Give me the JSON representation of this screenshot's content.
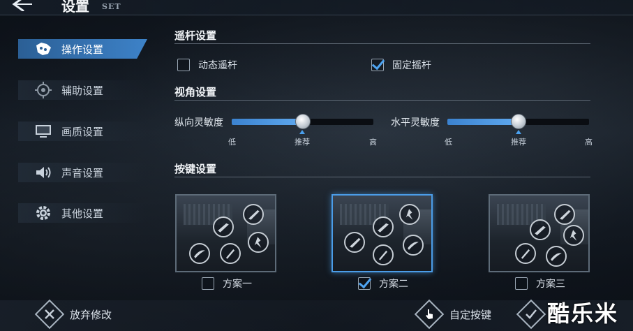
{
  "header": {
    "title": "设置",
    "subtitle": "SET"
  },
  "sidebar": {
    "items": [
      {
        "label": "操作设置",
        "icon": "gamepad-icon",
        "active": true
      },
      {
        "label": "辅助设置",
        "icon": "crosshair-icon",
        "active": false
      },
      {
        "label": "画质设置",
        "icon": "monitor-icon",
        "active": false
      },
      {
        "label": "声音设置",
        "icon": "speaker-icon",
        "active": false
      },
      {
        "label": "其他设置",
        "icon": "gear-icon",
        "active": false
      }
    ]
  },
  "joystick": {
    "title": "遥杆设置",
    "dynamic": {
      "label": "动态遥杆",
      "checked": false
    },
    "fixed": {
      "label": "固定摇杆",
      "checked": true
    }
  },
  "view": {
    "title": "视角设置",
    "vertical": {
      "label": "纵向灵敏度",
      "value": 0.5,
      "low": "低",
      "recommend": "推荐",
      "high": "高"
    },
    "horizontal": {
      "label": "水平灵敏度",
      "value": 0.5,
      "low": "低",
      "recommend": "推荐",
      "high": "高"
    }
  },
  "keys": {
    "title": "按键设置",
    "schemes": [
      {
        "label": "方案一",
        "checked": false
      },
      {
        "label": "方案二",
        "checked": true
      },
      {
        "label": "方案三",
        "checked": false
      }
    ]
  },
  "footer": {
    "discard": "放弃修改",
    "custom": "自定按键",
    "watermark": "酷乐米"
  },
  "colors": {
    "accent": "#4ea4f2",
    "active_tab": "#3d82c8"
  }
}
